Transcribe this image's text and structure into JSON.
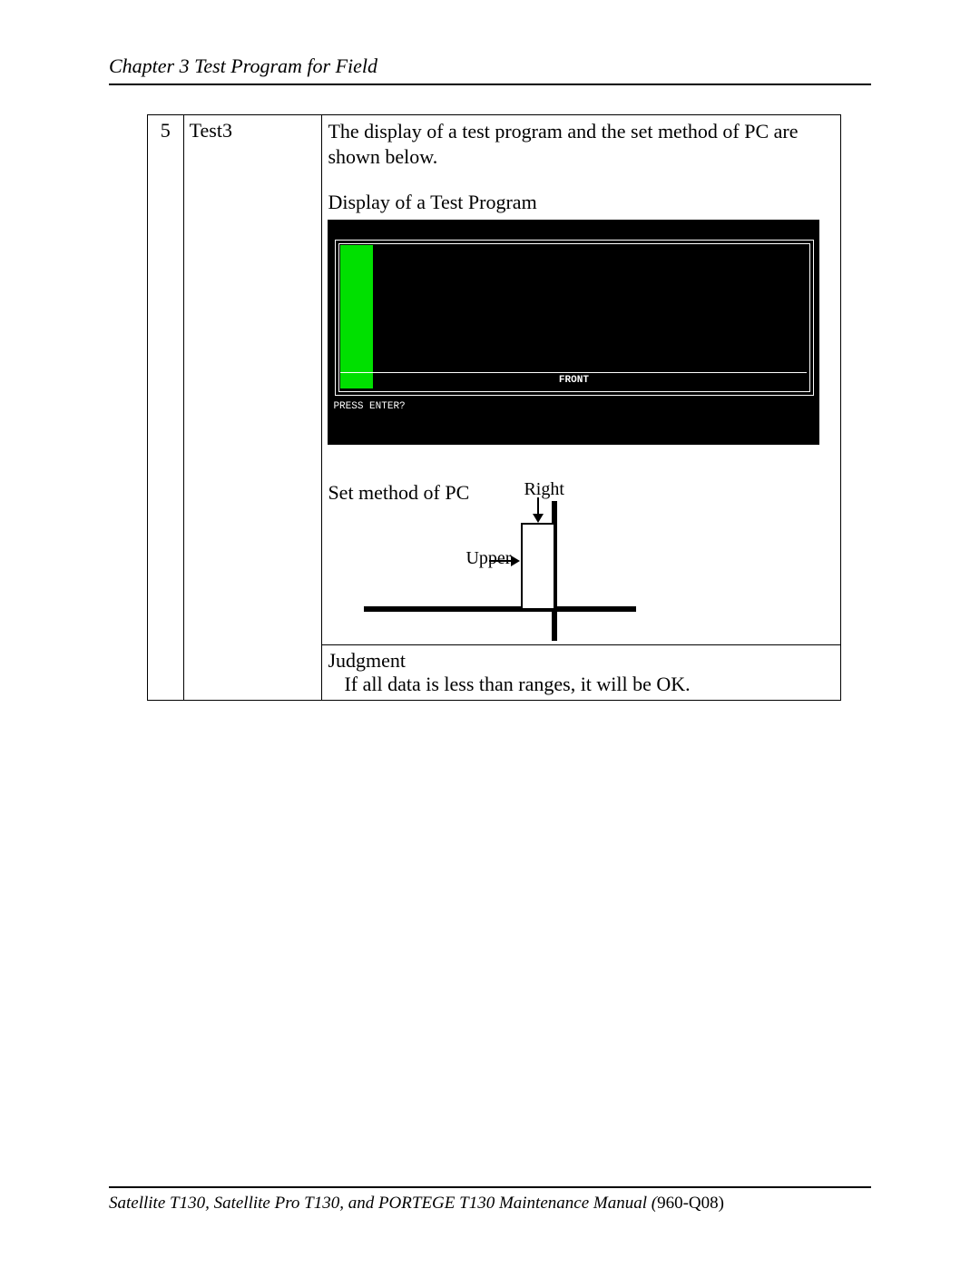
{
  "header": "Chapter 3 Test Program for Field",
  "row": {
    "num": "5",
    "name": "Test3",
    "intro": "The display of a test program and the set method of PC are shown below.",
    "caption_display": "Display of a Test Program",
    "screen": {
      "front": "FRONT",
      "press": "PRESS ENTER?"
    },
    "caption_setmethod": "Set method of PC",
    "label_right": "Right",
    "label_upper": "Upper",
    "judgment_heading": "Judgment",
    "judgment_body": "If all data is less than ranges, it will be OK."
  },
  "footer": {
    "title": "Satellite T130, Satellite Pro T130, and PORTEGE T130 Maintenance Manual (",
    "docno": "960-Q08)"
  }
}
